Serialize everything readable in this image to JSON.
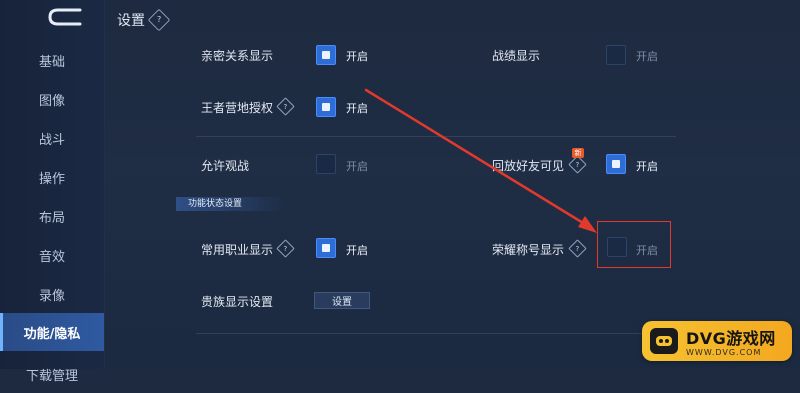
{
  "header": {
    "title": "设置",
    "help_icon": "?"
  },
  "sidebar": {
    "items": [
      {
        "label": "基础"
      },
      {
        "label": "图像"
      },
      {
        "label": "战斗"
      },
      {
        "label": "操作"
      },
      {
        "label": "布局"
      },
      {
        "label": "音效"
      },
      {
        "label": "录像"
      },
      {
        "label": "功能/隐私",
        "active": true
      },
      {
        "label": "下载管理"
      }
    ]
  },
  "settings": {
    "left_rows": [
      {
        "label": "亲密关系显示",
        "state": "开启",
        "checked": true
      },
      {
        "label": "王者营地授权",
        "state": "开启",
        "checked": true,
        "help": true
      },
      {
        "label": "允许观战",
        "state": "开启",
        "checked": false
      }
    ],
    "right_rows": [
      {
        "label": "战绩显示",
        "state": "开启",
        "checked": false
      },
      {
        "label": "回放好友可见",
        "state": "开启",
        "checked": true,
        "help": true,
        "badge": "新"
      }
    ],
    "section_title": "功能状态设置",
    "section_rows": {
      "common_job": {
        "label": "常用职业显示",
        "state": "开启",
        "checked": true
      },
      "honor_title": {
        "label": "荣耀称号显示",
        "state": "开启",
        "checked": false
      },
      "noble": {
        "label": "贵族显示设置",
        "button": "设置"
      }
    }
  },
  "annotation": {
    "color": "#e13a2c"
  },
  "watermark": {
    "title": "DVG游戏网",
    "subtitle": "WWW.DVG.COM"
  }
}
